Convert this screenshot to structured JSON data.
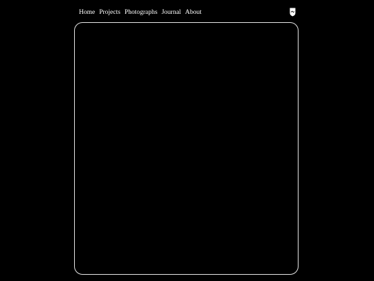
{
  "nav": {
    "items": [
      {
        "label": "Home"
      },
      {
        "label": "Projects"
      },
      {
        "label": "Photographs"
      },
      {
        "label": "Journal"
      },
      {
        "label": "About"
      }
    ]
  },
  "logo": {
    "icon": "shield-crest-icon"
  },
  "colors": {
    "background": "#000000",
    "text": "#ffffff",
    "panel_border": "#e6e6e6"
  }
}
